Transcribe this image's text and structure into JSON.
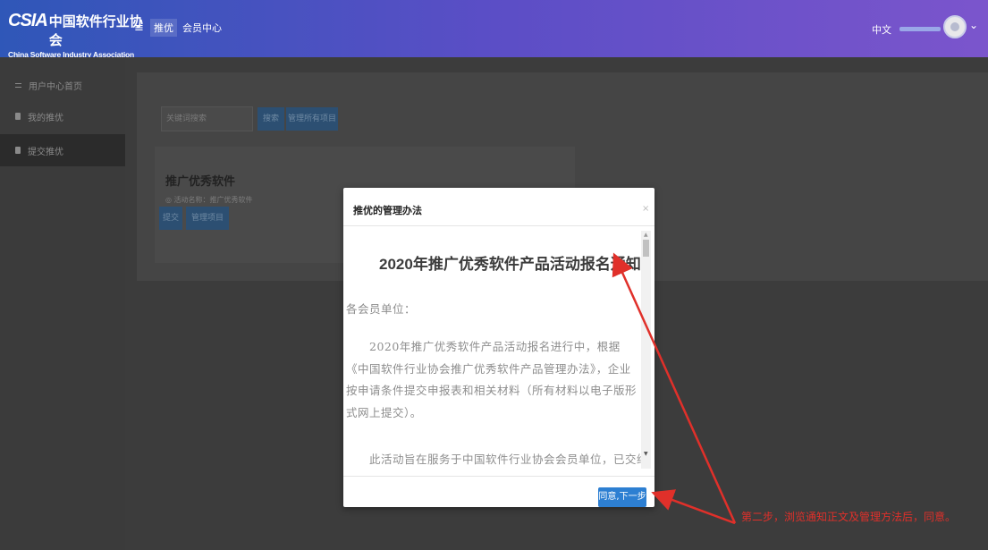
{
  "header": {
    "logo_mark": "CSIA",
    "logo_cn": "中国软件行业协会",
    "logo_en": "China Software Industry Association",
    "menu_icon": "hamburger-icon",
    "nav": [
      "推优",
      "会员中心"
    ],
    "lang": "中文"
  },
  "sidebar": {
    "items": [
      {
        "label": "用户中心首页",
        "icon": "list-icon"
      },
      {
        "label": "我的推优",
        "icon": "doc-icon"
      },
      {
        "label": "提交推优",
        "icon": "doc-icon"
      }
    ]
  },
  "main": {
    "search_placeholder": "关键词搜索",
    "search_button": "搜索",
    "manage_all_button": "管理所有项目",
    "card": {
      "title": "推广优秀软件",
      "subtitle": "◎ 活动名称：推广优秀软件",
      "submit_button": "提交",
      "manage_button": "管理项目"
    }
  },
  "modal": {
    "title": "推优的管理办法",
    "close": "×",
    "notice_title": "2020年推广优秀软件产品活动报名通知",
    "greeting": "各会员单位：",
    "paragraph": "2020年推广优秀软件产品活动报名进行中，根据《中国软件行业协会推广优秀软件产品管理办法》，企业按申请条件提交申报表和相关材料（所有材料以电子版形式网上提交）。",
    "last_line": "此活动旨在服务于中国软件行业协会会员单位，已交纳",
    "agree_button": "同意,下一步"
  },
  "annotation": {
    "text": "第二步，浏览通知正文及管理方法后，同意。",
    "color": "#e0302a"
  }
}
